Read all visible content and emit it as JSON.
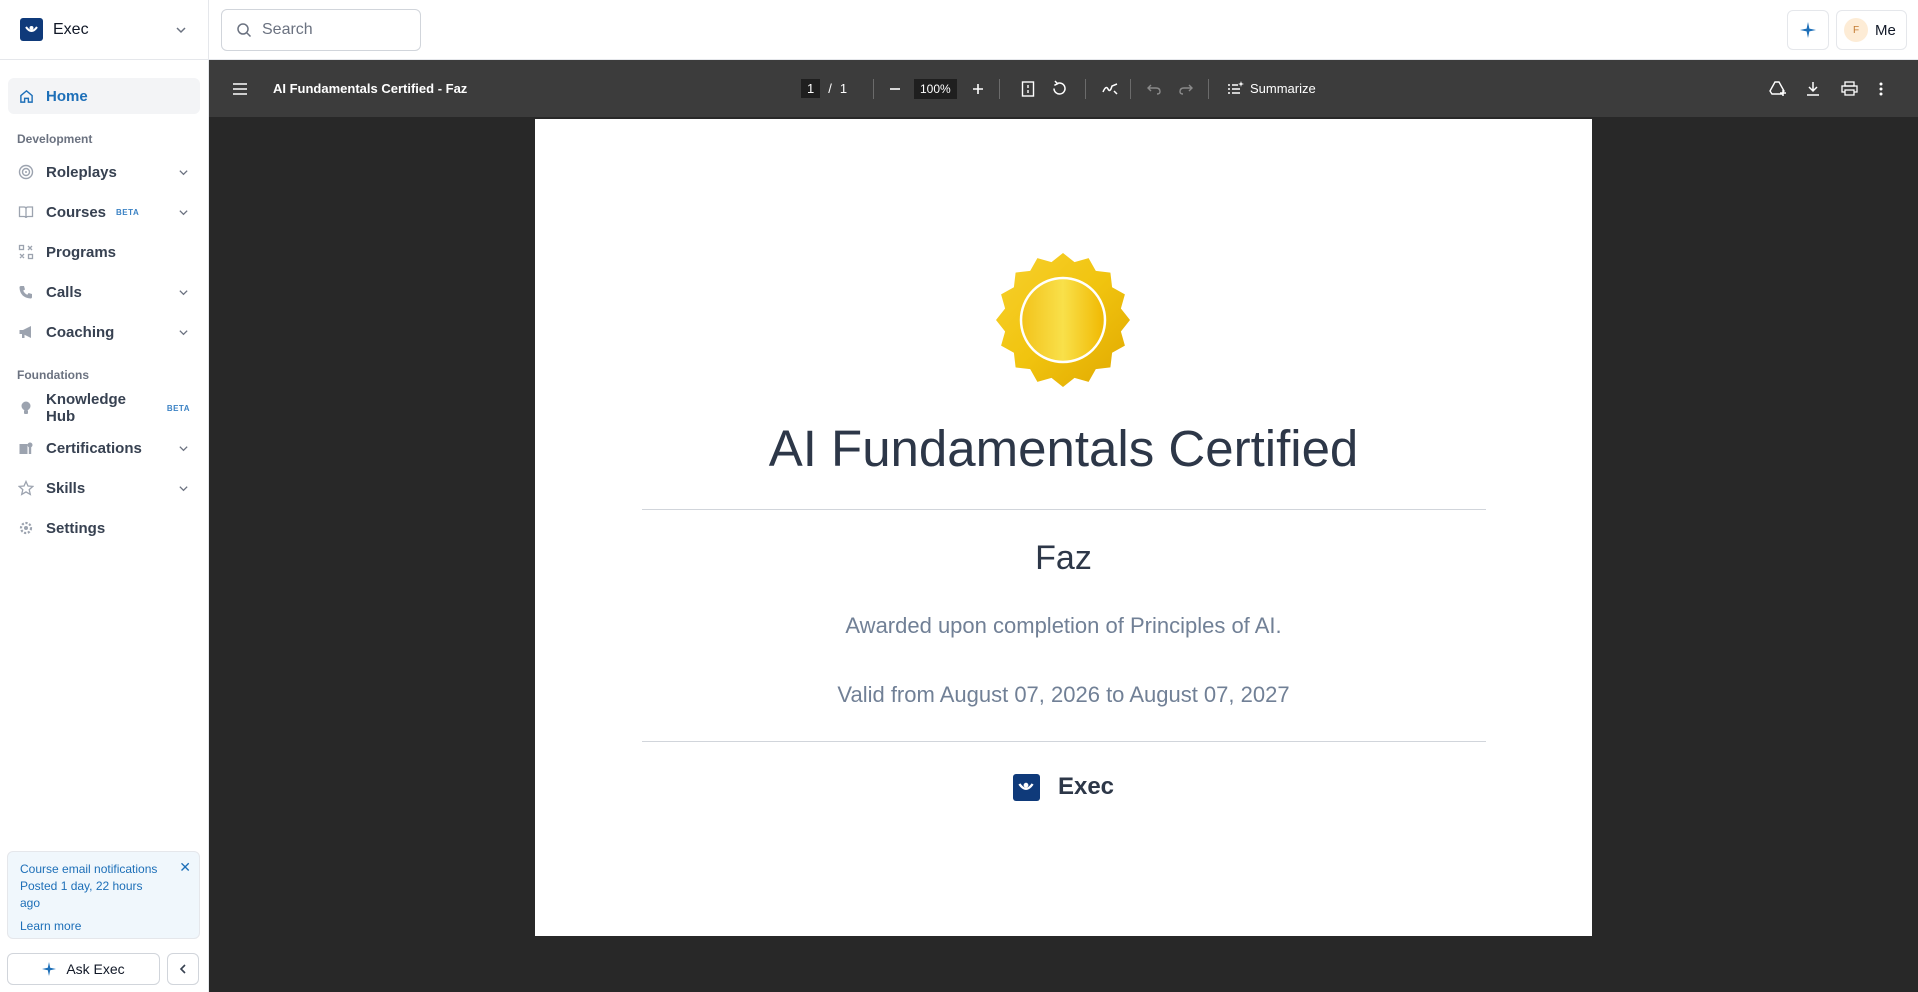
{
  "app": {
    "workspace": "Exec"
  },
  "search": {
    "placeholder": "Search"
  },
  "header": {
    "me_label": "Me",
    "avatar_initial": "F"
  },
  "sidebar": {
    "home": "Home",
    "sections": [
      {
        "title": "Development"
      },
      {
        "title": "Foundations"
      }
    ],
    "items": {
      "roleplays": "Roleplays",
      "courses": "Courses",
      "courses_badge": "BETA",
      "programs": "Programs",
      "calls": "Calls",
      "coaching": "Coaching",
      "knowledge_hub": "Knowledge Hub",
      "knowledge_hub_badge": "BETA",
      "certifications": "Certifications",
      "skills": "Skills",
      "settings": "Settings"
    },
    "notice": {
      "title": "Course email notifications",
      "posted": "Posted 1 day, 22 hours ago",
      "link": "Learn more"
    },
    "ask_button": "Ask Exec"
  },
  "pdf_toolbar": {
    "doc_title": "AI Fundamentals Certified - Faz",
    "current_page": "1",
    "page_sep": "/",
    "total_pages": "1",
    "zoom": "100%",
    "summarize": "Summarize"
  },
  "certificate": {
    "title": "AI Fundamentals Certified",
    "recipient": "Faz",
    "description": "Awarded upon completion of Principles of AI.",
    "validity": "Valid from August 07, 2026 to August 07, 2027",
    "brand": "Exec"
  },
  "colors": {
    "accent": "#1d6fb8",
    "logo": "#0f3a7a",
    "viewer_bg": "#282828",
    "toolbar_bg": "#3c3c3c",
    "seal": "#f2c318"
  }
}
